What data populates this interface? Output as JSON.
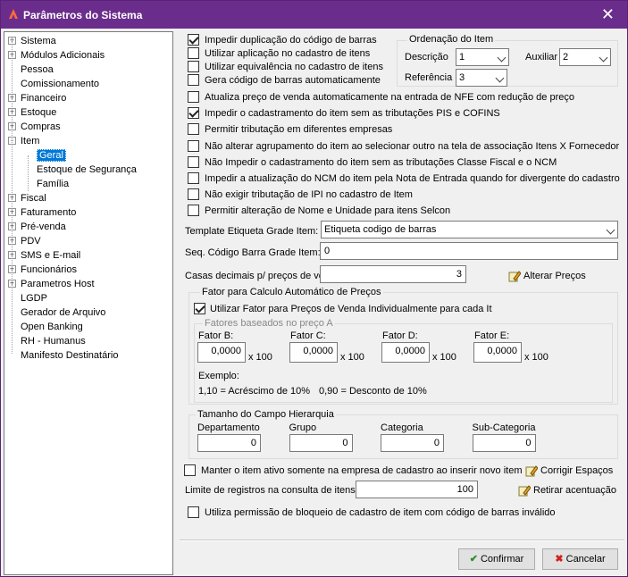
{
  "window": {
    "title": "Parâmetros do Sistema"
  },
  "tree": {
    "items": [
      {
        "label": "Sistema",
        "expander": "+"
      },
      {
        "label": "Módulos Adicionais",
        "expander": "+"
      },
      {
        "label": "Pessoa",
        "expander": ""
      },
      {
        "label": "Comissionamento",
        "expander": ""
      },
      {
        "label": "Financeiro",
        "expander": "+"
      },
      {
        "label": "Estoque",
        "expander": "+"
      },
      {
        "label": "Compras",
        "expander": "+"
      },
      {
        "label": "Item",
        "expander": "-"
      },
      {
        "label": "Geral",
        "expander": "",
        "child": true,
        "selected": true
      },
      {
        "label": "Estoque de Segurança",
        "expander": "",
        "child": true
      },
      {
        "label": "Família",
        "expander": "",
        "child": true
      },
      {
        "label": "Fiscal",
        "expander": "+"
      },
      {
        "label": "Faturamento",
        "expander": "+"
      },
      {
        "label": "Pré-venda",
        "expander": "+"
      },
      {
        "label": "PDV",
        "expander": "+"
      },
      {
        "label": "SMS e E-mail",
        "expander": "+"
      },
      {
        "label": "Funcionários",
        "expander": "+"
      },
      {
        "label": "Parametros Host",
        "expander": "+"
      },
      {
        "label": "LGDP",
        "expander": ""
      },
      {
        "label": "Gerador de Arquivo",
        "expander": ""
      },
      {
        "label": "Open Banking",
        "expander": ""
      },
      {
        "label": "RH - Humanus",
        "expander": ""
      },
      {
        "label": "Manifesto Destinatário",
        "expander": ""
      }
    ]
  },
  "top_checks": [
    {
      "label": "Impedir duplicação do código de barras",
      "checked": true
    },
    {
      "label": "Utilizar aplicação no cadastro de itens",
      "checked": false
    },
    {
      "label": "Utilizar equivalência no cadastro de itens",
      "checked": false
    },
    {
      "label": "Gera código de barras automaticamente",
      "checked": false
    }
  ],
  "ordenacao": {
    "title": "Ordenação do Item",
    "descricao_label": "Descrição",
    "descricao_value": "1",
    "auxiliar_label": "Auxiliar",
    "auxiliar_value": "2",
    "referencia_label": "Referência",
    "referencia_value": "3"
  },
  "checks": [
    {
      "label": "Atualiza preço de venda automaticamente na entrada de NFE com redução de preço",
      "checked": false
    },
    {
      "label": "Impedir o cadastramento do item sem as tributações PIS e COFINS",
      "checked": true
    },
    {
      "label": "Permitir tributação em diferentes empresas",
      "checked": false
    },
    {
      "label": "Não alterar agrupamento do item ao selecionar outro na tela de associação Itens X Fornecedor",
      "checked": false
    },
    {
      "label": "Não Impedir o cadastramento do item sem as tributações Classe Fiscal e o NCM",
      "checked": false
    },
    {
      "label": "Impedir a atualização do NCM do item pela Nota de Entrada quando for divergente do cadastro",
      "checked": false
    },
    {
      "label": "Não exigir tributação de IPI no cadastro de Item",
      "checked": false
    },
    {
      "label": "Permitir alteração de Nome e Unidade para itens Selcon",
      "checked": false
    }
  ],
  "template": {
    "label": "Template Etiqueta Grade Item:",
    "value": "Etiqueta codigo de  barras"
  },
  "seq": {
    "label": "Seq. Código Barra Grade Item:",
    "value": "0"
  },
  "casas": {
    "label": "Casas decimais p/ preços de venda:",
    "value": "3",
    "button": "Alterar Preços"
  },
  "fator": {
    "title": "Fator para Calculo Automático de Preços",
    "check_label": "Utilizar Fator para Preços de Venda Individualmente para cada Item",
    "checked": true,
    "sub_title": "Fatores baseados no preço A",
    "fields": [
      {
        "label": "Fator B:",
        "value": "0,0000",
        "suffix": "x 100"
      },
      {
        "label": "Fator C:",
        "value": "0,0000",
        "suffix": "x 100"
      },
      {
        "label": "Fator D:",
        "value": "0,0000",
        "suffix": "x 100"
      },
      {
        "label": "Fator E:",
        "value": "0,0000",
        "suffix": "x 100"
      }
    ],
    "example_title": "Exemplo:",
    "example_1": "1,10 = Acréscimo de 10%",
    "example_2": "0,90 = Desconto de 10%"
  },
  "hierarquia": {
    "title": "Tamanho do Campo Hierarquia",
    "fields": [
      {
        "label": "Departamento",
        "value": "0"
      },
      {
        "label": "Grupo",
        "value": "0"
      },
      {
        "label": "Categoria",
        "value": "0"
      },
      {
        "label": "Sub-Categoria",
        "value": "0"
      }
    ]
  },
  "manter": {
    "label": "Manter o item ativo somente na empresa de cadastro ao inserir novo item",
    "checked": false,
    "button": "Corrigir Espaços"
  },
  "limite": {
    "label": "Limite de registros na consulta de itens:",
    "value": "100",
    "button": "Retirar acentuação"
  },
  "bloqueio": {
    "label": "Utiliza permissão de bloqueio de cadastro de item com código de barras inválido",
    "checked": false
  },
  "footer": {
    "confirm": "Confirmar",
    "cancel": "Cancelar"
  }
}
